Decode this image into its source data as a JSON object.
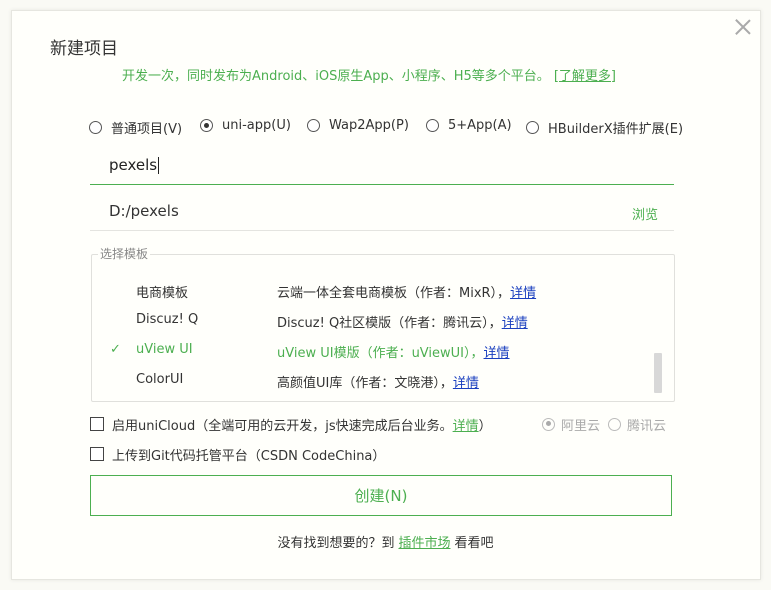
{
  "dialog": {
    "title": "新建项目",
    "subtitle": "开发一次，同时发布为Android、iOS原生App、小程序、H5等多个平台。",
    "learn_more": "[了解更多]"
  },
  "project_types": [
    {
      "label": "普通项目(V)",
      "selected": false
    },
    {
      "label": "uni-app(U)",
      "selected": true
    },
    {
      "label": "Wap2App(P)",
      "selected": false
    },
    {
      "label": "5+App(A)",
      "selected": false
    },
    {
      "label": "HBuilderX插件扩展(E)",
      "selected": false
    }
  ],
  "project_name": {
    "value": "pexels"
  },
  "project_path": {
    "value": "D:/pexels",
    "browse_label": "浏览"
  },
  "templates": {
    "legend": "选择模板",
    "detail_label": "详情",
    "items": [
      {
        "name": "电商模板",
        "desc": "云端一体全套电商模板（作者：MixR），",
        "detail": "详情",
        "selected": false
      },
      {
        "name": "Discuz! Q",
        "desc": "Discuz! Q社区模版（作者：腾讯云），",
        "detail": "详情",
        "selected": false
      },
      {
        "name": "uView UI",
        "desc": "uView UI模版（作者：uViewUI），",
        "detail": "详情",
        "selected": true
      },
      {
        "name": "ColorUI",
        "desc": "高颜值UI库（作者：文晓港），",
        "detail": "详情",
        "selected": false
      }
    ],
    "check_mark": "✓"
  },
  "unicloud": {
    "label": "启用uniCloud（全端可用的云开发，js快速完成后台业务。",
    "detail": "详情",
    "suffix": "）",
    "checked": false,
    "providers": [
      {
        "label": "阿里云",
        "selected": true
      },
      {
        "label": "腾讯云",
        "selected": false
      }
    ]
  },
  "git": {
    "label": "上传到Git代码托管平台（CSDN CodeChina）",
    "checked": false
  },
  "create_button": "创建(N)",
  "footer": {
    "prefix": "没有找到想要的？到",
    "market": "插件市场",
    "suffix": "看看吧"
  },
  "colors": {
    "accent": "#4caf50",
    "link": "#1a3fbf"
  }
}
